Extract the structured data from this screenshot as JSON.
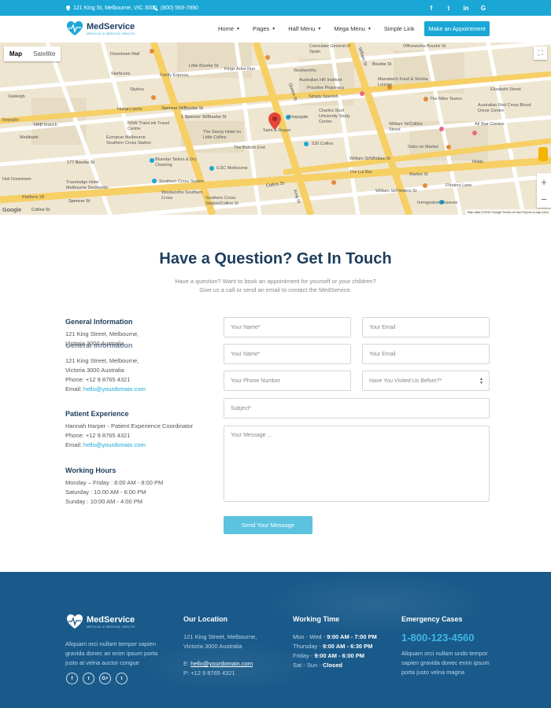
{
  "topbar": {
    "address": "121 King St, Melbourne, VIC 3000",
    "phone": "(800) 569-7890",
    "social": [
      "f",
      "t",
      "in",
      "G"
    ]
  },
  "header": {
    "brand": "MedService",
    "tagline": "MEDICAL & MEDICAL HEALTH",
    "nav": [
      "Home",
      "Pages",
      "Half Menu",
      "Mega Menu",
      "Simple Link"
    ],
    "cta": "Make an Appointment"
  },
  "map": {
    "type_map": "Map",
    "type_satellite": "Satellite",
    "attribution": "Map data ©2019 Google   Terms of Use   Report a map error",
    "google": "Google",
    "zoom_in": "+",
    "zoom_out": "−",
    "labels": {
      "l1": "Downtown Mall",
      "l2": "Starbucks",
      "l3": "Skybus",
      "l4": "Hungry jacks",
      "l5": "NAB branch",
      "l6": "Medibank",
      "l7": "Republic",
      "l8": "Oakleigh",
      "l9": "NSW TrainLink Travel Centre",
      "l10": "Europcar Melbourne Southern Cross Station",
      "l11": "The Savoy Hotel on Little Collins",
      "l12": "The Bottom End",
      "l13": "Bluestar Tailors & Dry Cleaning",
      "l14": "ILSC Melbourne",
      "l15": "Southern Cross Station",
      "l16": "Woolworths Southern Cross",
      "l17": "Southern Cross Station/Collins St",
      "l18": "Travelodge Hotel Melbourne Docklands",
      "l19": "Holi Downtown",
      "l20": "Platform 28",
      "l21": "Firefly Express",
      "l22": "Little Bourke St",
      "l23": "Kings Artist Run",
      "l24": "Woolworths",
      "l25": "Australian HR Institute",
      "l26": "Priceline Pharmacy",
      "l27": "Simply Spanish",
      "l28": "Consulate General of Spain",
      "l29": "Charles Sturt University Study Centre",
      "l30": "Saint & Rogue",
      "l31": "Kingsgate",
      "l32": "530 Collins",
      "l33": "Officeworks Bourke St",
      "l34": "Marrakech Food & Shisha Lounge",
      "l35": "The Mitre Tavern",
      "l36": "Elizabeth Street",
      "l37": "Australian Red Cross Blood Donor Centre",
      "l38": "All Star Comics",
      "l39": "Oaks on Market",
      "l40": "The Lui Bar",
      "l41": "Market St",
      "l42": "Flinders Lane",
      "l43": "Immigration Museum",
      "l44": "William St/Collins Street",
      "l45": "William St/Whitlaw St",
      "l46": "William St/Flinders St",
      "l47": "Rialto"
    },
    "streets": {
      "s1": "Spencer St/Bourke St",
      "s2": "1 Spencer St/Bourke St",
      "s3": "Spencer St",
      "s4": "King St",
      "s5": "William St",
      "s6": "Queen St",
      "s7": "Collins St",
      "s8": "Bourke St",
      "s9": "177 Bourke St",
      "s10": "Collins St"
    }
  },
  "contact": {
    "title": "Have a Question? Get In Touch",
    "intro_line1": "Have a question? Want to book an appointment for yourself or your children?",
    "intro_line2": "Give us a call or send an email to contact the MedService.",
    "general": {
      "heading": "General Information",
      "address1": "121 King Street, Melbourne,",
      "address2": "Victoria 3000 Australia",
      "ghost": "General Information",
      "address3": "121 King Street, Melbourne,",
      "address4": "Victoria 3000 Australia",
      "phone": "Phone: +12 9 8765 4321",
      "email_label": "Email: ",
      "email": "hello@yourdomain.com"
    },
    "patient": {
      "heading": "Patient Experience",
      "name": "Hannah Harper - Patient Experience Coordinator",
      "phone": "Phone: +12 9 8765 4321",
      "email_label": "Email: ",
      "email": "hello@yourdomain.com"
    },
    "hours": {
      "heading": "Working Hours",
      "weekday": "Monday – Friday : 8:00 AM - 8:00 PM",
      "saturday": "Saturday : 10:00 AM - 6:00 PM",
      "sunday": "Sunday : 10:00 AM - 4:00 PM"
    },
    "form": {
      "name1": "Your Name*",
      "email1": "Your Email",
      "name2": "Your Name*",
      "email2": "Your Email",
      "phone": "Your Phone Number",
      "visited": "Have You Visited Us Before?*",
      "subject": "Subject*",
      "message": "Your Message ...",
      "send": "Send Your Message"
    }
  },
  "footer": {
    "brand": "MedService",
    "tagline": "MEDICAL & MEDICAL HEALTH",
    "about": "Aliquam orci nullam tempor sapien gravida donec an enim ipsum porta justo at velna auctor congue",
    "social": [
      "f",
      "t",
      "G+",
      "t"
    ],
    "location": {
      "heading": "Our Location",
      "addr1": "121 King Street, Melbourne,",
      "addr2": "Victoria 3000 Australia",
      "email_label": "E: ",
      "email": "hello@yourdomain.com",
      "phone": "P: +12 9 8765 4321"
    },
    "working": {
      "heading": "Working Time",
      "r1_day": "Mon - Wed - ",
      "r1_time": "9:00 AM - 7:00 PM",
      "r2_day": "Thursday - ",
      "r2_time": "9:00 AM - 6:30 PM",
      "r3_day": "Friday - ",
      "r3_time": "9:00 AM - 6:00 PM",
      "r4_day": "Sat - Sun - ",
      "r4_time": "Closed"
    },
    "emergency": {
      "heading": "Emergency Cases",
      "phone": "1-800-123-4560",
      "text": "Aliquam orci nullam undo tempor sapien gravida donec enim ipsum porta justo velna magna"
    }
  },
  "colors": {
    "accent": "#1aa7d6",
    "navy": "#1d3d5c",
    "footer_bg": "#1a5a8a",
    "button_light": "#5bc2df",
    "map_road": "#f6cf65",
    "map_pin": "#e5453a"
  }
}
